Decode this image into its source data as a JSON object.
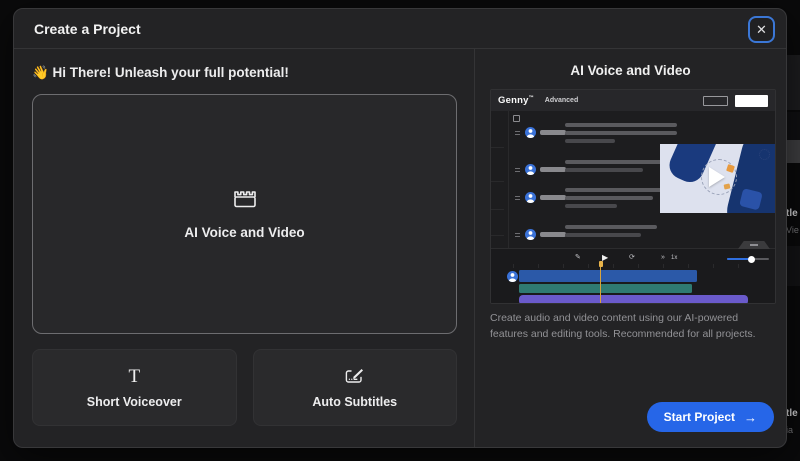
{
  "background": {
    "fragments": {
      "f1": "tle",
      "f2": "Vie",
      "f3": "tle",
      "f4": "ia"
    }
  },
  "modal": {
    "title": "Create a Project",
    "close": "✕"
  },
  "left": {
    "greeting": "👋 Hi There! Unleash your full potential!",
    "main_card": {
      "label": "AI Voice and Video"
    },
    "cards": [
      {
        "label": "Short Voiceover",
        "glyph": "T"
      },
      {
        "label": "Auto Subtitles"
      }
    ]
  },
  "right": {
    "title": "AI Voice and Video",
    "preview": {
      "brand": "Genny",
      "brand_mark": "™",
      "mode": "Advanced",
      "toolbar": {
        "trim": "✎",
        "play": "▶",
        "loop": "⟳",
        "ff": "»",
        "speed": "1x"
      }
    },
    "description": "Create audio and video content using our AI-powered features and editing tools. Recommended for all projects.",
    "start_button": {
      "label": "Start Project",
      "arrow": "→"
    }
  },
  "colors": {
    "accent": "#2666e8",
    "close_ring": "#3b77d6",
    "track_blue": "#2b59a8",
    "track_teal": "#2f7a72",
    "track_purple": "#6a5acb",
    "playhead": "#d9a43c"
  }
}
